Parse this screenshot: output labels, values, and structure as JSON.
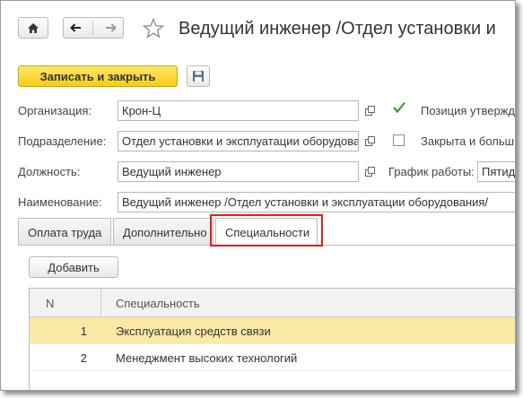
{
  "toolbar": {
    "home_icon": "home-icon",
    "back_icon": "arrow-left-icon",
    "forward_icon": "arrow-right-icon",
    "favorite_icon": "star-icon",
    "title": "Ведущий инженер /Отдел установки и"
  },
  "commands": {
    "save_close_label": "Записать и закрыть",
    "save_icon": "floppy-disk-icon"
  },
  "form": {
    "organization_label": "Организация:",
    "organization_value": "Крон-Ц",
    "department_label": "Подразделение:",
    "department_value": "Отдел установки и эксплуатации оборудова",
    "position_label": "Должность:",
    "position_value": "Ведущий инженер",
    "name_label": "Наименование:",
    "name_value": "Ведущий инженер /Отдел установки и эксплуатации оборудования/",
    "approved_label": "Позиция утвержд",
    "approved_checked": true,
    "closed_label": "Закрыта и больш",
    "closed_checked": false,
    "schedule_label": "График работы:",
    "schedule_value": "Пятид"
  },
  "tabs": [
    {
      "label": "Оплата труда"
    },
    {
      "label": "Дополнительно"
    },
    {
      "label": "Специальности"
    }
  ],
  "table": {
    "add_button_label": "Добавить",
    "columns": {
      "n": "N",
      "specialty": "Специальность"
    },
    "rows": [
      {
        "n": "1",
        "specialty": "Эксплуатация средств связи"
      },
      {
        "n": "2",
        "specialty": "Менеджмент высоких технологий"
      }
    ]
  },
  "colors": {
    "primary_button": "#f7cd16",
    "selected_row": "#f9e8a6",
    "highlight_frame": "#e02020",
    "checkmark": "#3a9a3a"
  }
}
